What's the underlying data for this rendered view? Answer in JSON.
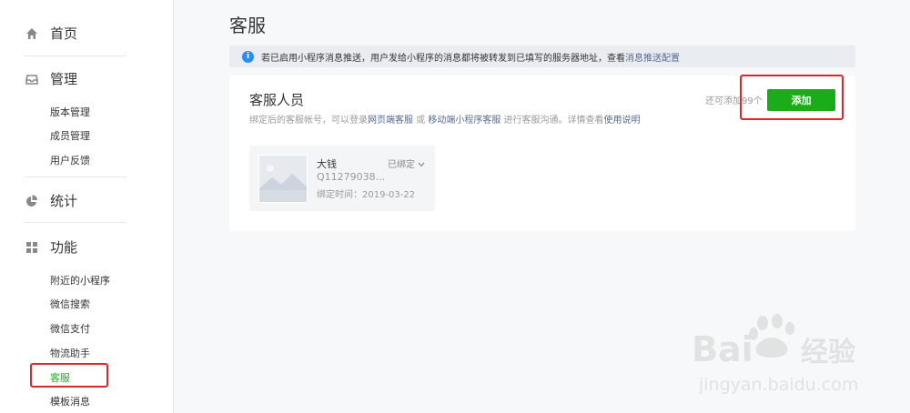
{
  "sidebar": {
    "home_label": "首页",
    "manage": {
      "label": "管理",
      "items": [
        "版本管理",
        "成员管理",
        "用户反馈"
      ]
    },
    "stats_label": "统计",
    "features": {
      "label": "功能",
      "items": [
        "附近的小程序",
        "微信搜索",
        "微信支付",
        "物流助手",
        "客服",
        "模板消息"
      ]
    },
    "active_item": "客服"
  },
  "main": {
    "title": "客服",
    "notice": {
      "icon": "info-icon",
      "text": "若已启用小程序消息推送，用户发给小程序的消息都将被转发到已填写的服务器地址，查看 ",
      "link": "消息推送配置"
    },
    "card": {
      "title": "客服人员",
      "desc_1": "绑定后的客服帐号，可以登录",
      "link_1": "网页端客服",
      "desc_2": " 或 ",
      "link_2": "移动端小程序客服",
      "desc_3": " 进行客服沟通。详情查看",
      "link_3": "使用说明",
      "quota": "还可添加99个",
      "add_label": "添加",
      "member": {
        "name": "大钱",
        "status": "已绑定",
        "account": "Q11279038...",
        "bind_time": "绑定时间：2019-03-22"
      }
    }
  },
  "watermark": {
    "logo_text": "Bai du 经验",
    "url": "jingyan.baidu.com"
  },
  "colors": {
    "accent": "#1aad19",
    "link": "#576b95",
    "highlight": "#e0262b",
    "info": "#2a8cf7"
  }
}
